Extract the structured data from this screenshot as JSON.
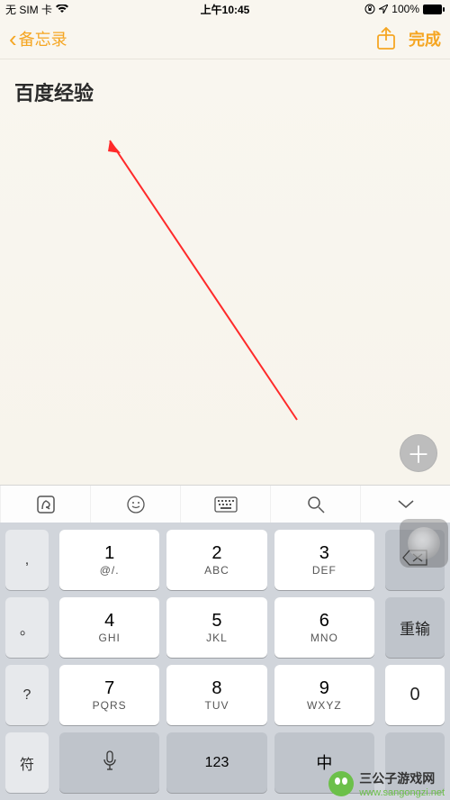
{
  "status": {
    "carrier": "无 SIM 卡",
    "time": "上午10:45",
    "battery": "100%"
  },
  "nav": {
    "back_label": "备忘录",
    "done_label": "完成"
  },
  "note": {
    "content": "百度经验"
  },
  "keyboard": {
    "left_keys": [
      ",",
      "。",
      "?",
      "符"
    ],
    "grid": [
      {
        "num": "1",
        "letters": "@/."
      },
      {
        "num": "2",
        "letters": "ABC"
      },
      {
        "num": "3",
        "letters": "DEF"
      },
      {
        "num": "4",
        "letters": "GHI"
      },
      {
        "num": "5",
        "letters": "JKL"
      },
      {
        "num": "6",
        "letters": "MNO"
      },
      {
        "num": "7",
        "letters": "PQRS"
      },
      {
        "num": "8",
        "letters": "TUV"
      },
      {
        "num": "9",
        "letters": "WXYZ"
      },
      {
        "num": "",
        "letters": "",
        "icon": "mic"
      },
      {
        "num": "123",
        "letters": ""
      },
      {
        "num": "",
        "letters": "中"
      }
    ],
    "right_keys": {
      "backspace": "⌫",
      "reenter": "重输",
      "zero": "0"
    }
  },
  "watermark": {
    "title": "三公子游戏网",
    "url": "www.sangongzi.net"
  },
  "colors": {
    "accent": "#f5a623",
    "kb_bg": "#d1d5db"
  }
}
